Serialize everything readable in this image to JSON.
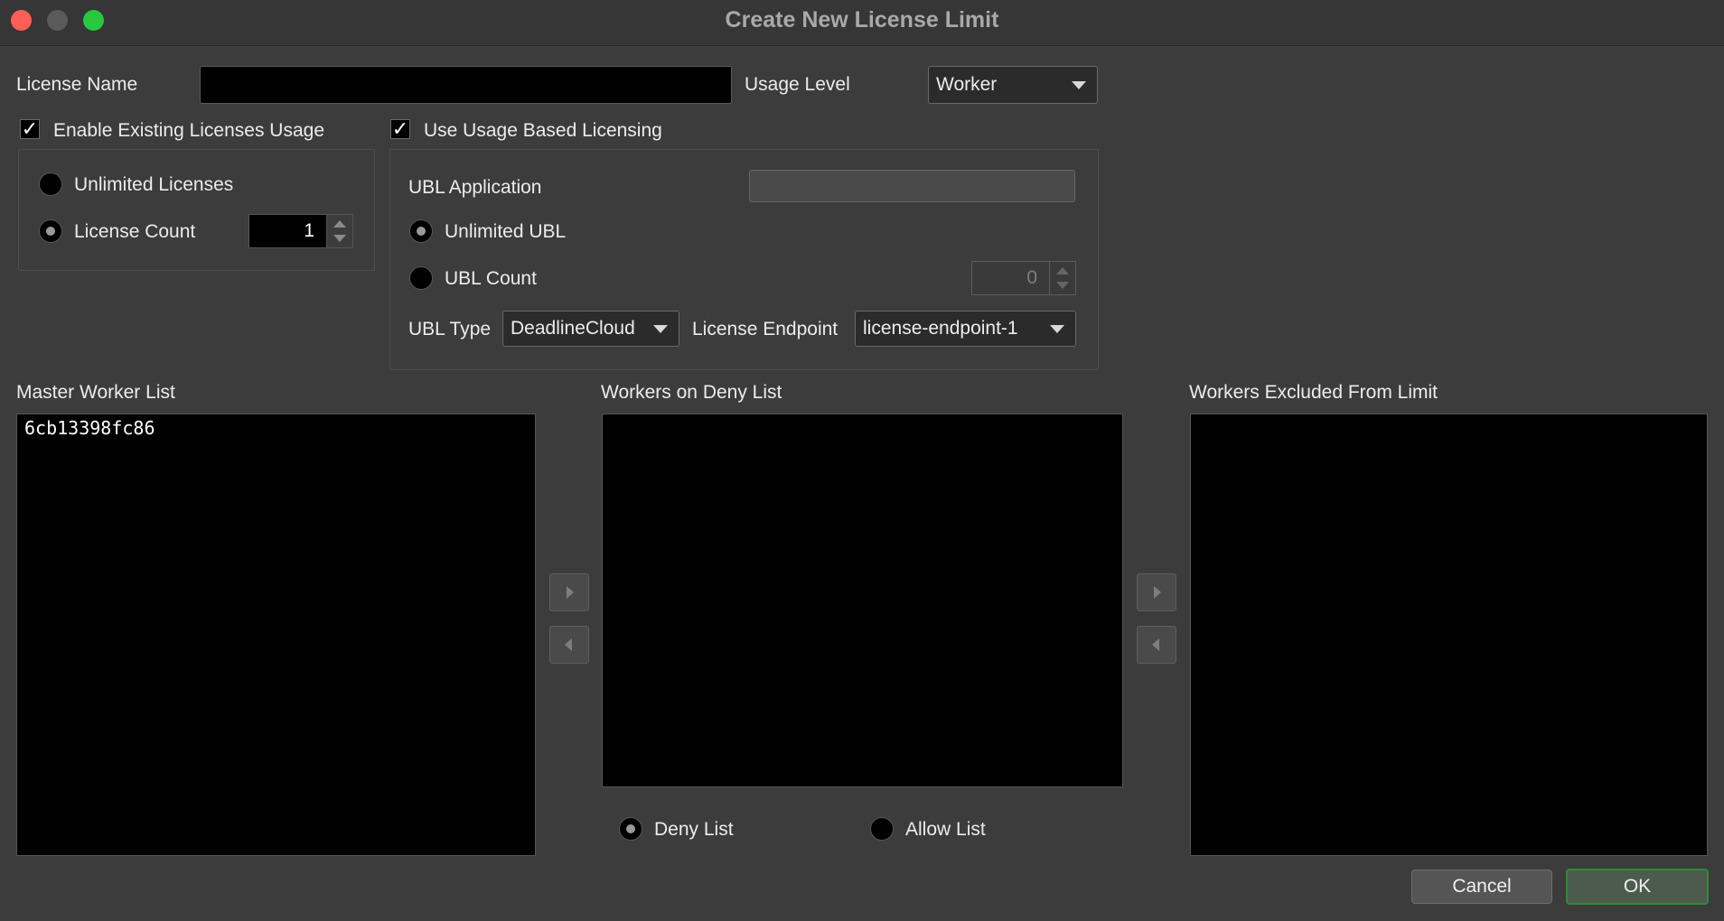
{
  "window": {
    "title": "Create New License Limit",
    "traffic_lights": {
      "close": "#ff5f57",
      "minimize": "#5a5a5a",
      "zoom": "#28c840"
    }
  },
  "license_name": {
    "label": "License Name",
    "value": ""
  },
  "usage_level": {
    "label": "Usage Level",
    "value": "Worker"
  },
  "existing": {
    "checkbox_label": "Enable Existing Licenses Usage",
    "checked": true,
    "unlimited_label": "Unlimited Licenses",
    "count_label": "License Count",
    "count_value": "1",
    "selected": "License Count"
  },
  "ubl": {
    "checkbox_label": "Use Usage Based Licensing",
    "checked": true,
    "application_label": "UBL Application",
    "application_value": "",
    "unlimited_label": "Unlimited UBL",
    "count_label": "UBL Count",
    "count_value": "0",
    "selected": "Unlimited UBL",
    "type_label": "UBL Type",
    "type_value": "DeadlineCloud",
    "endpoint_label": "License Endpoint",
    "endpoint_value": "license-endpoint-1"
  },
  "lists": {
    "master_label": "Master Worker List",
    "master_items": [
      "6cb13398fc86"
    ],
    "deny_label": "Workers on Deny List",
    "deny_items": [],
    "excluded_label": "Workers Excluded From Limit",
    "excluded_items": []
  },
  "list_mode": {
    "deny_label": "Deny List",
    "allow_label": "Allow List",
    "selected": "Deny List"
  },
  "buttons": {
    "cancel": "Cancel",
    "ok": "OK"
  },
  "colors": {
    "ok_border": "#2f8a3a",
    "background": "#3c3c3c"
  }
}
